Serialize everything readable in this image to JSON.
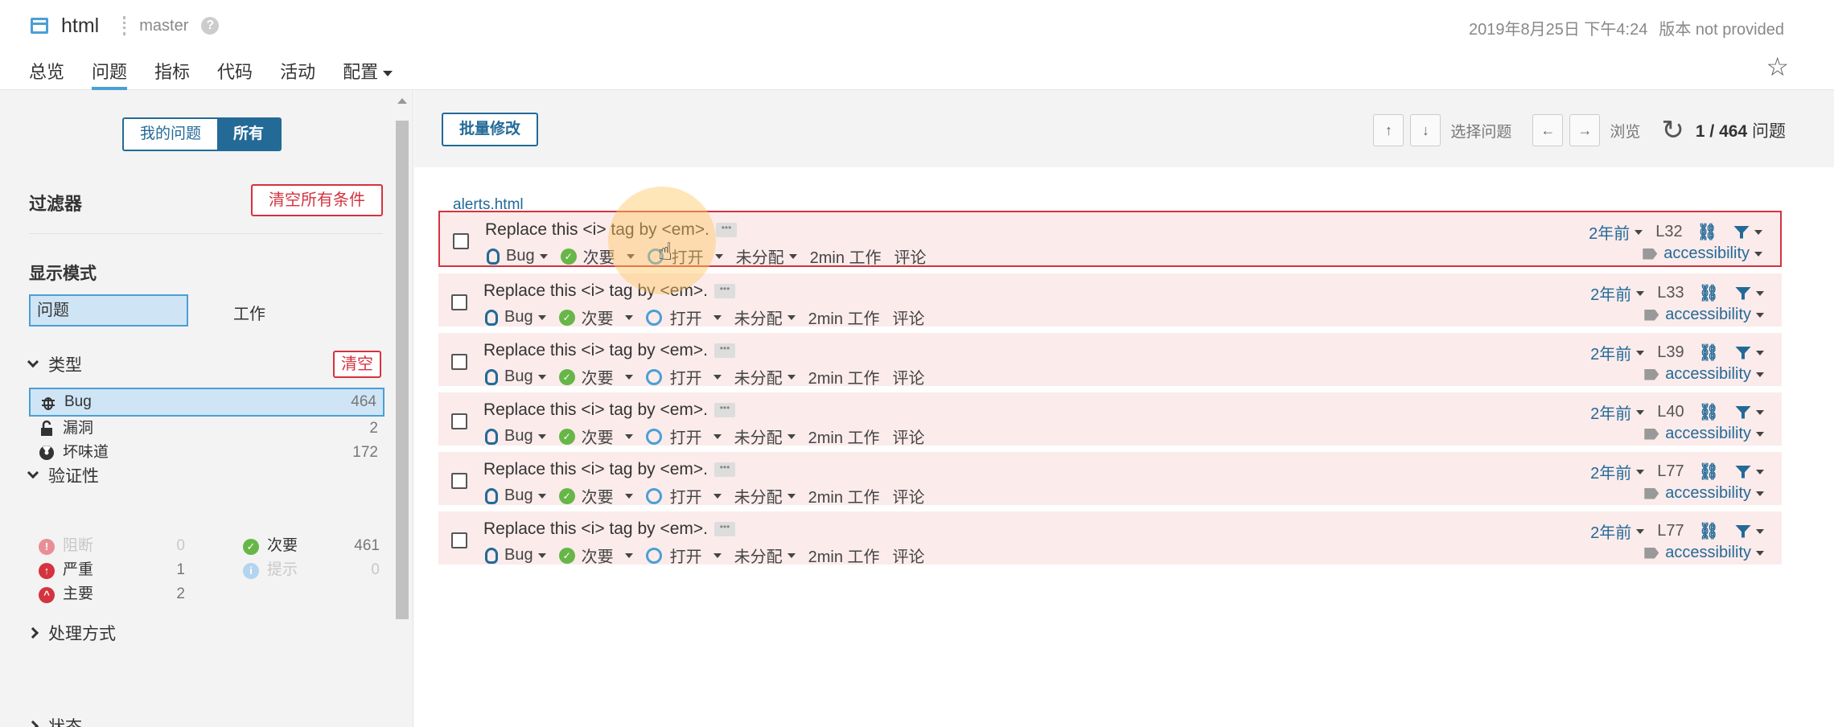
{
  "header": {
    "project": "html",
    "branch": "master",
    "date": "2019年8月25日 下午4:24",
    "version": "版本 not provided",
    "tabs": [
      {
        "label": "总览"
      },
      {
        "label": "问题"
      },
      {
        "label": "指标"
      },
      {
        "label": "代码"
      },
      {
        "label": "活动"
      },
      {
        "label": "配置"
      }
    ]
  },
  "sidebar": {
    "scope_mine": "我的问题",
    "scope_all": "所有",
    "filters_title": "过滤器",
    "clear_all": "清空所有条件",
    "display_mode_title": "显示模式",
    "mode_issues": "问题",
    "mode_effort": "工作",
    "type_title": "类型",
    "type_clear": "清空",
    "types": [
      {
        "label": "Bug",
        "count": "464",
        "icon": "bug-icon"
      },
      {
        "label": "漏洞",
        "count": "2",
        "icon": "lock-open-icon"
      },
      {
        "label": "坏味道",
        "count": "172",
        "icon": "radiation-icon"
      }
    ],
    "severity_title": "验证性",
    "severities": [
      {
        "label": "阻断",
        "count": "0",
        "color": "#d4333f"
      },
      {
        "label": "次要",
        "count": "461",
        "color": "#67b648"
      },
      {
        "label": "严重",
        "count": "1",
        "color": "#d4333f"
      },
      {
        "label": "提示",
        "count": "0",
        "color": "#4b9fd5"
      },
      {
        "label": "主要",
        "count": "2",
        "color": "#d4333f"
      }
    ],
    "resolution_title": "处理方式",
    "status_title": "状态"
  },
  "toolbar": {
    "bulk_change": "批量修改",
    "select_label": "选择问题",
    "browse_label": "浏览",
    "up": "↑",
    "down": "↓",
    "left": "←",
    "right": "→",
    "count": "1 / 464",
    "count_suffix": "问题"
  },
  "file": "alerts.html",
  "issues": [
    {
      "message": "Replace this <i> tag by <em>.",
      "type": "Bug",
      "severity": "次要",
      "status": "打开",
      "assignee": "未分配",
      "effort": "2min 工作",
      "comment": "评论",
      "age": "2年前",
      "line": "L32",
      "tag": "accessibility"
    },
    {
      "message": "Replace this <i> tag by <em>.",
      "type": "Bug",
      "severity": "次要",
      "status": "打开",
      "assignee": "未分配",
      "effort": "2min 工作",
      "comment": "评论",
      "age": "2年前",
      "line": "L33",
      "tag": "accessibility"
    },
    {
      "message": "Replace this <i> tag by <em>.",
      "type": "Bug",
      "severity": "次要",
      "status": "打开",
      "assignee": "未分配",
      "effort": "2min 工作",
      "comment": "评论",
      "age": "2年前",
      "line": "L39",
      "tag": "accessibility"
    },
    {
      "message": "Replace this <i> tag by <em>.",
      "type": "Bug",
      "severity": "次要",
      "status": "打开",
      "assignee": "未分配",
      "effort": "2min 工作",
      "comment": "评论",
      "age": "2年前",
      "line": "L40",
      "tag": "accessibility"
    },
    {
      "message": "Replace this <i> tag by <em>.",
      "type": "Bug",
      "severity": "次要",
      "status": "打开",
      "assignee": "未分配",
      "effort": "2min 工作",
      "comment": "评论",
      "age": "2年前",
      "line": "L77",
      "tag": "accessibility"
    },
    {
      "message": "Replace this <i> tag by <em>.",
      "type": "Bug",
      "severity": "次要",
      "status": "打开",
      "assignee": "未分配",
      "effort": "2min 工作",
      "comment": "评论",
      "age": "2年前",
      "line": "L77",
      "tag": "accessibility"
    }
  ]
}
